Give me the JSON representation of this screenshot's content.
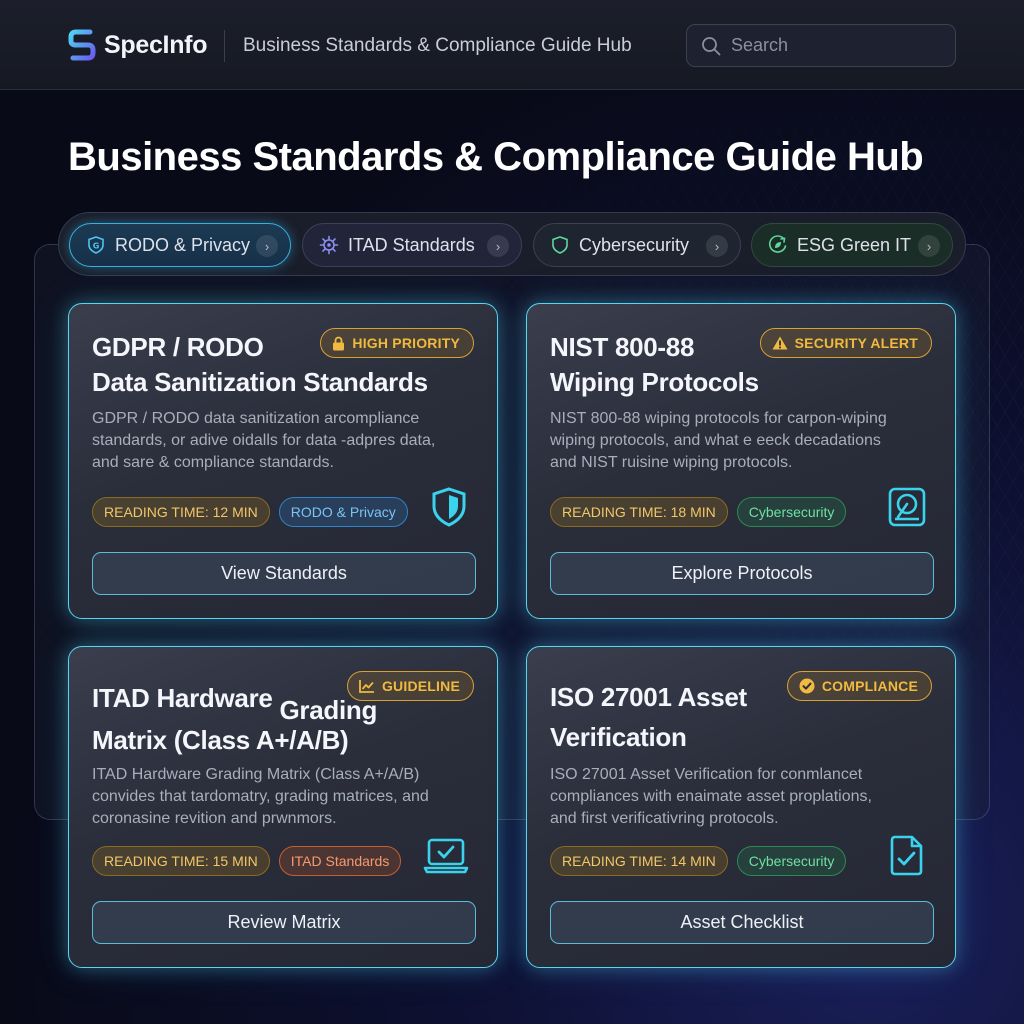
{
  "header": {
    "logo_text": "SpecInfo",
    "title": "Business Standards & Compliance Guide Hub",
    "search_placeholder": "Search"
  },
  "page_title": "Business Standards & Compliance Guide Hub",
  "tabs": [
    {
      "label": "RODO & Privacy",
      "icon": "shield-g-icon",
      "active": true
    },
    {
      "label": "ITAD Standards",
      "icon": "chip-icon",
      "active": false
    },
    {
      "label": "Cybersecurity",
      "icon": "shield-icon",
      "active": false
    },
    {
      "label": "ESG Green IT",
      "icon": "leaf-recycle-icon",
      "active": false
    }
  ],
  "cards": [
    {
      "title_line1": "GDPR / RODO",
      "title_line2": "Data Sanitization Standards",
      "badge": "HIGH PRIORITY",
      "badge_icon": "lock-icon",
      "desc_lines": [
        "GDPR / RODO data sanitization arcompliance",
        "standards, or adive oidalls for data -adpres data,",
        "and sare & compliance standards."
      ],
      "reading_time": "READING TIME: 12 MIN",
      "category": "RODO & Privacy",
      "icon": "shield-icon",
      "button": "View Standards"
    },
    {
      "title_line1": "NIST 800-88",
      "title_line2": "Wiping Protocols",
      "badge": "SECURITY ALERT",
      "badge_icon": "warning-icon",
      "desc_lines": [
        "NIST 800-88 wiping protocols for carpon-wiping",
        "wiping protocols, and what e eeck decadations",
        "and NIST ruisine wiping protocols."
      ],
      "reading_time": "READING TIME: 18 MIN",
      "category": "Cybersecurity",
      "icon": "hard-drive-icon",
      "button": "Explore Protocols"
    },
    {
      "title_line1": "ITAD Hardware",
      "title_line1b": "Grading",
      "title_line2": "Matrix (Class A+/A/B)",
      "badge": "GUIDELINE",
      "badge_icon": "chart-line-icon",
      "desc_lines": [
        "ITAD Hardware Grading Matrix (Class A+/A/B)",
        "convides that tardomatry, grading matrices, and",
        "coronasine revition and prwnmors."
      ],
      "reading_time": "READING TIME: 15 MIN",
      "category": "ITAD Standards",
      "icon": "laptop-check-icon",
      "button": "Review Matrix"
    },
    {
      "title_line1": "ISO 27001 Asset",
      "title_line2": "Verification",
      "badge": "COMPLIANCE",
      "badge_icon": "check-circle-icon",
      "desc_lines": [
        "ISO 27001 Asset Verification for conmlancet",
        "compliances with enaimate asset proplations,",
        "and first verificativring protocols."
      ],
      "reading_time": "READING TIME: 14 MIN",
      "category": "Cybersecurity",
      "icon": "document-check-icon",
      "button": "Asset Checklist"
    }
  ],
  "colors": {
    "accent_cyan": "#58d6f0",
    "badge_amber": "#f0b93f",
    "background": "#090a18"
  }
}
